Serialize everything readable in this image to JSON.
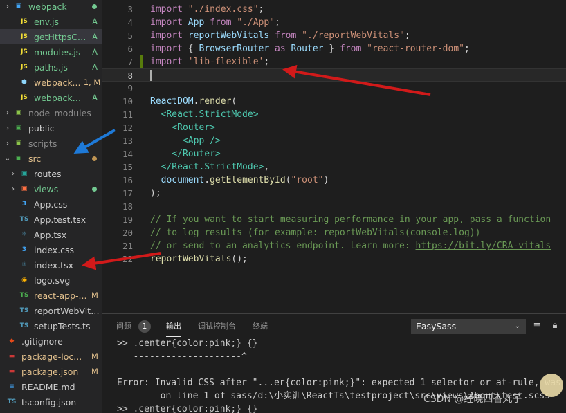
{
  "explorer": {
    "items": [
      {
        "chev": "›",
        "icon": "folder-icon",
        "icon_color": "#42a5f5",
        "glyph": "▣",
        "name": "webpack",
        "status": "",
        "dot": "#73c991",
        "color": "#73c991",
        "indent": 0
      },
      {
        "chev": "",
        "icon": "js-file-icon",
        "icon_color": "#f1dd35",
        "glyph": "JS",
        "name": "env.js",
        "status": "A",
        "dot": "",
        "color": "#73c991",
        "indent": 18
      },
      {
        "chev": "",
        "icon": "js-file-icon",
        "icon_color": "#f1dd35",
        "glyph": "JS",
        "name": "getHttpsCo...",
        "status": "A",
        "dot": "",
        "color": "#73c991",
        "indent": 18,
        "selected": true
      },
      {
        "chev": "",
        "icon": "js-file-icon",
        "icon_color": "#f1dd35",
        "glyph": "JS",
        "name": "modules.js",
        "status": "A",
        "dot": "",
        "color": "#73c991",
        "indent": 18
      },
      {
        "chev": "",
        "icon": "js-file-icon",
        "icon_color": "#f1dd35",
        "glyph": "JS",
        "name": "paths.js",
        "status": "A",
        "dot": "",
        "color": "#73c991",
        "indent": 18
      },
      {
        "chev": "",
        "icon": "webpack-file-icon",
        "icon_color": "#8ed6fb",
        "glyph": "⬢",
        "name": "webpack...",
        "status": "1, M",
        "dot": "",
        "color": "#e2c08d",
        "indent": 18
      },
      {
        "chev": "",
        "icon": "js-file-icon",
        "icon_color": "#f1dd35",
        "glyph": "JS",
        "name": "webpackDe...",
        "status": "A",
        "dot": "",
        "color": "#73c991",
        "indent": 18
      },
      {
        "chev": "›",
        "icon": "node-folder-icon",
        "icon_color": "#8bc34a",
        "glyph": "▣",
        "name": "node_modules",
        "status": "",
        "dot": "",
        "color": "#8c8c8c",
        "indent": 0
      },
      {
        "chev": "›",
        "icon": "public-folder-icon",
        "icon_color": "#4caf50",
        "glyph": "▣",
        "name": "public",
        "status": "",
        "dot": "",
        "color": "#cccccc",
        "indent": 0
      },
      {
        "chev": "›",
        "icon": "scripts-folder-icon",
        "icon_color": "#8bc34a",
        "glyph": "▣",
        "name": "scripts",
        "status": "",
        "dot": "",
        "color": "#8c8c8c",
        "indent": 0
      },
      {
        "chev": "⌄",
        "icon": "src-folder-icon",
        "icon_color": "#4caf50",
        "glyph": "▣",
        "name": "src",
        "status": "",
        "dot": "#c09553",
        "color": "#e2c08d",
        "indent": 0
      },
      {
        "chev": "›",
        "icon": "routes-folder-icon",
        "icon_color": "#26a69a",
        "glyph": "▣",
        "name": "routes",
        "status": "",
        "dot": "",
        "color": "#cccccc",
        "indent": 8
      },
      {
        "chev": "›",
        "icon": "views-folder-icon",
        "icon_color": "#ff7043",
        "glyph": "▣",
        "name": "views",
        "status": "",
        "dot": "#73c991",
        "color": "#73c991",
        "indent": 8
      },
      {
        "chev": "",
        "icon": "css-file-icon",
        "icon_color": "#42a5f5",
        "glyph": "3",
        "name": "App.css",
        "status": "",
        "dot": "",
        "color": "#cccccc",
        "indent": 18
      },
      {
        "chev": "",
        "icon": "ts-file-icon",
        "icon_color": "#519aba",
        "glyph": "TS",
        "name": "App.test.tsx",
        "status": "",
        "dot": "",
        "color": "#cccccc",
        "indent": 18
      },
      {
        "chev": "",
        "icon": "tsx-file-icon",
        "icon_color": "#519aba",
        "glyph": "⚛",
        "name": "App.tsx",
        "status": "",
        "dot": "",
        "color": "#cccccc",
        "indent": 18
      },
      {
        "chev": "",
        "icon": "css-file-icon",
        "icon_color": "#42a5f5",
        "glyph": "3",
        "name": "index.css",
        "status": "",
        "dot": "",
        "color": "#cccccc",
        "indent": 18
      },
      {
        "chev": "",
        "icon": "tsx-file-icon",
        "icon_color": "#519aba",
        "glyph": "⚛",
        "name": "index.tsx",
        "status": "",
        "dot": "",
        "color": "#cccccc",
        "indent": 18,
        "active": true
      },
      {
        "chev": "",
        "icon": "svg-file-icon",
        "icon_color": "#ffb300",
        "glyph": "◉",
        "name": "logo.svg",
        "status": "",
        "dot": "",
        "color": "#cccccc",
        "indent": 18
      },
      {
        "chev": "",
        "icon": "ts-file-icon",
        "icon_color": "#4caf50",
        "glyph": "TS",
        "name": "react-app-...",
        "status": "M",
        "dot": "",
        "color": "#e2c08d",
        "indent": 18
      },
      {
        "chev": "",
        "icon": "ts-file-icon",
        "icon_color": "#519aba",
        "glyph": "TS",
        "name": "reportWebVitals...",
        "status": "",
        "dot": "",
        "color": "#cccccc",
        "indent": 18
      },
      {
        "chev": "",
        "icon": "ts-file-icon",
        "icon_color": "#519aba",
        "glyph": "TS",
        "name": "setupTests.ts",
        "status": "",
        "dot": "",
        "color": "#cccccc",
        "indent": 18
      },
      {
        "chev": "",
        "icon": "git-file-icon",
        "icon_color": "#e64a19",
        "glyph": "◆",
        "name": ".gitignore",
        "status": "",
        "dot": "",
        "color": "#cccccc",
        "indent": 0
      },
      {
        "chev": "",
        "icon": "npm-file-icon",
        "icon_color": "#cb3837",
        "glyph": "▬",
        "name": "package-loc...",
        "status": "M",
        "dot": "",
        "color": "#e2c08d",
        "indent": 0
      },
      {
        "chev": "",
        "icon": "npm-file-icon",
        "icon_color": "#cb3837",
        "glyph": "▬",
        "name": "package.json",
        "status": "M",
        "dot": "",
        "color": "#e2c08d",
        "indent": 0
      },
      {
        "chev": "",
        "icon": "readme-file-icon",
        "icon_color": "#42a5f5",
        "glyph": "≡",
        "name": "README.md",
        "status": "",
        "dot": "",
        "color": "#cccccc",
        "indent": 0
      },
      {
        "chev": "",
        "icon": "tsconfig-file-icon",
        "icon_color": "#519aba",
        "glyph": "TS",
        "name": "tsconfig.json",
        "status": "",
        "dot": "",
        "color": "#cccccc",
        "indent": 0
      }
    ]
  },
  "editor": {
    "active_line": "8",
    "lines": [
      {
        "n": "3",
        "tokens": [
          [
            "kw",
            "import "
          ],
          [
            "str",
            "\"./index.css\""
          ],
          [
            "txt",
            ";"
          ]
        ]
      },
      {
        "n": "4",
        "tokens": [
          [
            "kw",
            "import "
          ],
          [
            "id",
            "App "
          ],
          [
            "kw",
            "from "
          ],
          [
            "str",
            "\"./App\""
          ],
          [
            "txt",
            ";"
          ]
        ]
      },
      {
        "n": "5",
        "tokens": [
          [
            "kw",
            "import "
          ],
          [
            "id",
            "reportWebVitals "
          ],
          [
            "kw",
            "from "
          ],
          [
            "str",
            "\"./reportWebVitals\""
          ],
          [
            "txt",
            ";"
          ]
        ]
      },
      {
        "n": "6",
        "tokens": [
          [
            "kw",
            "import "
          ],
          [
            "txt",
            "{ "
          ],
          [
            "id",
            "BrowserRouter "
          ],
          [
            "kw",
            "as "
          ],
          [
            "id",
            "Router "
          ],
          [
            "txt",
            "} "
          ],
          [
            "kw",
            "from "
          ],
          [
            "str",
            "\"react-router-dom\""
          ],
          [
            "txt",
            ";"
          ]
        ]
      },
      {
        "n": "7",
        "tokens": [
          [
            "kw",
            "import "
          ],
          [
            "str",
            "'lib-flexible'"
          ],
          [
            "txt",
            ";"
          ]
        ]
      },
      {
        "n": "8",
        "tokens": []
      },
      {
        "n": "9",
        "tokens": []
      },
      {
        "n": "10",
        "tokens": [
          [
            "id",
            "ReactDOM"
          ],
          [
            "txt",
            "."
          ],
          [
            "fn",
            "render"
          ],
          [
            "txt",
            "("
          ]
        ]
      },
      {
        "n": "11",
        "tokens": [
          [
            "txt",
            "  "
          ],
          [
            "tag",
            "<React.StrictMode"
          ],
          [
            "tag",
            ">"
          ]
        ]
      },
      {
        "n": "12",
        "tokens": [
          [
            "txt",
            "    "
          ],
          [
            "tag",
            "<Router>"
          ]
        ]
      },
      {
        "n": "13",
        "tokens": [
          [
            "txt",
            "      "
          ],
          [
            "tag",
            "<App "
          ],
          [
            "tag",
            "/>"
          ]
        ]
      },
      {
        "n": "14",
        "tokens": [
          [
            "txt",
            "    "
          ],
          [
            "tag",
            "</Router>"
          ]
        ]
      },
      {
        "n": "15",
        "tokens": [
          [
            "txt",
            "  "
          ],
          [
            "tag",
            "</React.StrictMode>"
          ],
          [
            "txt",
            ","
          ]
        ]
      },
      {
        "n": "16",
        "tokens": [
          [
            "txt",
            "  "
          ],
          [
            "id",
            "document"
          ],
          [
            "txt",
            "."
          ],
          [
            "fn",
            "getElementById"
          ],
          [
            "txt",
            "("
          ],
          [
            "str",
            "\"root\""
          ],
          [
            "txt",
            ")"
          ]
        ]
      },
      {
        "n": "17",
        "tokens": [
          [
            "txt",
            ");"
          ]
        ]
      },
      {
        "n": "18",
        "tokens": []
      },
      {
        "n": "19",
        "tokens": [
          [
            "cm",
            "// If you want to start measuring performance in your app, pass a function"
          ]
        ]
      },
      {
        "n": "20",
        "tokens": [
          [
            "cm",
            "// to log results (for example: reportWebVitals(console.log))"
          ]
        ]
      },
      {
        "n": "21",
        "tokens": [
          [
            "cm",
            "// or send to an analytics endpoint. Learn more: "
          ],
          [
            "link",
            "https://bit.ly/CRA-vitals"
          ]
        ]
      },
      {
        "n": "22",
        "tokens": [
          [
            "fn",
            "reportWebVitals"
          ],
          [
            "txt",
            "();"
          ]
        ]
      }
    ]
  },
  "panel": {
    "tabs": [
      {
        "label": "问题",
        "active": false
      },
      {
        "label": "输出",
        "active": true
      },
      {
        "label": "调试控制台",
        "active": false
      },
      {
        "label": "终端",
        "active": false
      }
    ],
    "problems_count": "1",
    "channel": "EasySass",
    "output": [
      ">> .center{color:pink;} {}",
      "   --------------------^",
      "",
      "Error: Invalid CSS after \"...er{color:pink;}\": expected 1 selector or at-rule, was \"{}\"",
      "        on line 1 of sass/d:\\小实训\\ReactTs\\testproject\\src\\views\\About\\test.scss",
      ">> .center{color:pink;} {}"
    ]
  },
  "watermark": "CSDN @经晓四香丸子",
  "colors": {
    "arrow_red": "#d11a1a",
    "arrow_blue": "#1e7ad8"
  }
}
